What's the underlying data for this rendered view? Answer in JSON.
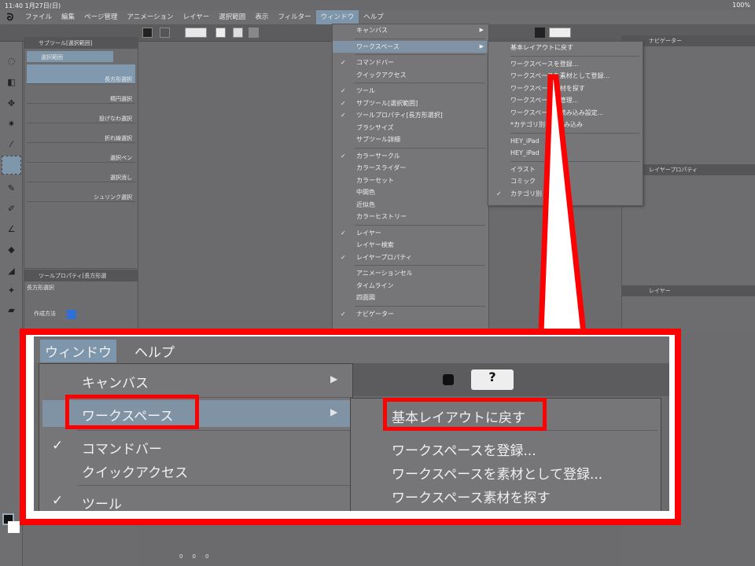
{
  "status": {
    "time": "11:40  1月27日(日)",
    "battery": "100%"
  },
  "menubar": {
    "items": [
      "ファイル",
      "編集",
      "ページ管理",
      "アニメーション",
      "レイヤー",
      "選択範囲",
      "表示",
      "フィルター",
      "ウィンドウ",
      "ヘルプ"
    ]
  },
  "subtool": {
    "title": "サブツール[選択範囲]",
    "group": "選択範囲",
    "items": [
      "長方形選択",
      "楕円選択",
      "投げなわ選択",
      "折れ線選択",
      "選択ペン",
      "選択消し",
      "シュリンク選択"
    ]
  },
  "toolprop": {
    "title": "ツールプロパティ[長方形選",
    "name": "長方形選択",
    "method_label": "作成方法"
  },
  "right": {
    "navigator": "ナビゲーター",
    "layer_property": "レイヤープロパティ",
    "layer": "レイヤー"
  },
  "window_menu": {
    "items": [
      {
        "label": "キャンバス",
        "check": false,
        "arrow": true
      },
      {
        "sep": true
      },
      {
        "label": "ワークスペース",
        "check": false,
        "arrow": true,
        "selected": true
      },
      {
        "sep": true
      },
      {
        "label": "コマンドバー",
        "check": true
      },
      {
        "label": "クイックアクセス",
        "check": false
      },
      {
        "sep": true
      },
      {
        "label": "ツール",
        "check": true
      },
      {
        "label": "サブツール[選択範囲]",
        "check": true
      },
      {
        "label": "ツールプロパティ[長方形選択]",
        "check": true
      },
      {
        "label": "ブラシサイズ",
        "check": false
      },
      {
        "label": "サブツール詳細",
        "check": false
      },
      {
        "sep": true
      },
      {
        "label": "カラーサークル",
        "check": true
      },
      {
        "label": "カラースライダー",
        "check": false
      },
      {
        "label": "カラーセット",
        "check": false
      },
      {
        "label": "中間色",
        "check": false
      },
      {
        "label": "近似色",
        "check": false
      },
      {
        "label": "カラーヒストリー",
        "check": false
      },
      {
        "sep": true
      },
      {
        "label": "レイヤー",
        "check": true
      },
      {
        "label": "レイヤー検索",
        "check": false
      },
      {
        "label": "レイヤープロパティ",
        "check": true
      },
      {
        "sep": true
      },
      {
        "label": "アニメーションセル",
        "check": false
      },
      {
        "label": "タイムライン",
        "check": false
      },
      {
        "label": "四面図",
        "check": false
      },
      {
        "sep": true
      },
      {
        "label": "ナビゲーター",
        "check": true
      }
    ]
  },
  "workspace_menu": {
    "items": [
      {
        "label": "基本レイアウトに戻す"
      },
      {
        "sep": true
      },
      {
        "label": "ワークスペースを登録..."
      },
      {
        "label": "ワークスペースを素材として登録..."
      },
      {
        "label": "ワークスペース素材を探す"
      },
      {
        "label": "ワークスペースの管理..."
      },
      {
        "label": "ワークスペースの読み込み設定..."
      },
      {
        "label": "*カテゴリ別を再読み込み"
      },
      {
        "sep": true
      },
      {
        "label": "HEY_iPad"
      },
      {
        "label": "HEY_iPad"
      },
      {
        "sep": true
      },
      {
        "label": "イラスト"
      },
      {
        "label": "コミック"
      },
      {
        "label": "カテゴリ別",
        "check": true
      }
    ]
  },
  "callout": {
    "menu_window": "ウィンドウ",
    "menu_help": "ヘルプ",
    "canvas": "キャンバス",
    "workspace": "ワークスペース",
    "commandbar": "コマンドバー",
    "quickaccess": "クイックアクセス",
    "tool": "ツール",
    "reset": "基本レイアウトに戻す",
    "register": "ワークスペースを登録...",
    "register_material": "ワークスペースを素材として登録...",
    "find_material": "ワークスペース素材を探す",
    "check": "✓",
    "arrow": "▶",
    "help": "?"
  },
  "color": {
    "h": "0",
    "s": "0",
    "v": "0"
  },
  "colors": {
    "highlight": "#7f93a5",
    "annotation": "#ff0000"
  }
}
